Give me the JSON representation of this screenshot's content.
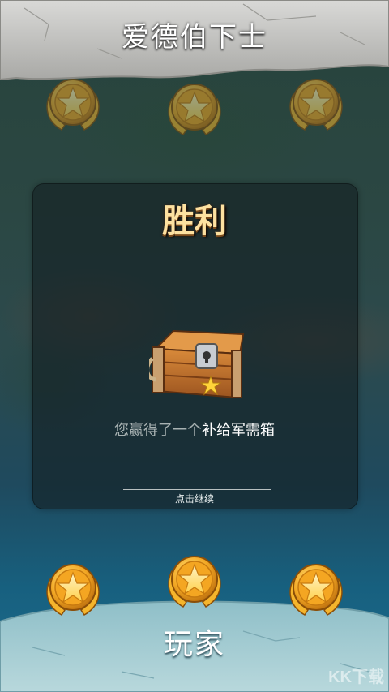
{
  "header": {
    "opponent_name": "爱德伯下士"
  },
  "footer": {
    "player_name": "玩家"
  },
  "result": {
    "title": "胜利",
    "reward_prefix": "您赢得了一个",
    "reward_item": "补给军需箱",
    "continue_label": "点击继续"
  },
  "opponent_medals": {
    "earned": 0,
    "total": 3
  },
  "player_medals": {
    "earned": 3,
    "total": 3
  },
  "watermark": "KK下载",
  "icons": {
    "medal": "star-medal-icon",
    "chest": "supply-chest-icon"
  }
}
